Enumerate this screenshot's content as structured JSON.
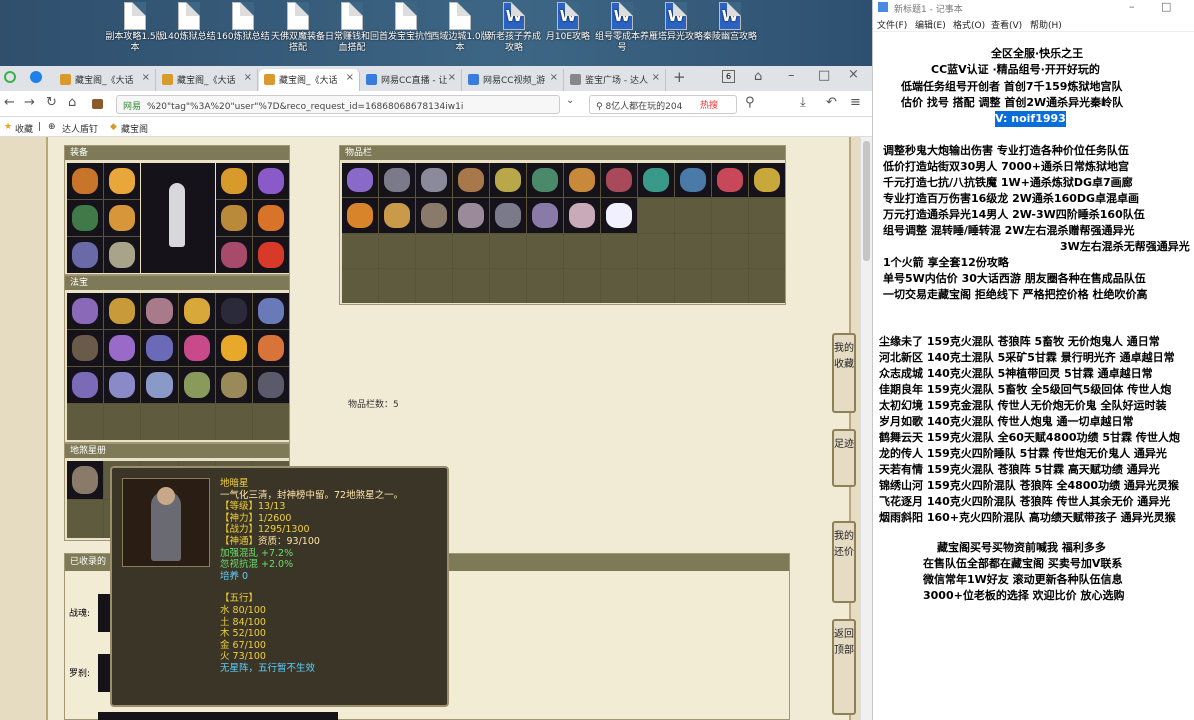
{
  "desktop": {
    "icons": [
      {
        "label": "副本攻略1.5版本",
        "type": "doc"
      },
      {
        "label": "140炼狱总结",
        "type": "doc"
      },
      {
        "label": "160炼狱总结",
        "type": "doc"
      },
      {
        "label": "天佛双魔装备搭配",
        "type": "doc"
      },
      {
        "label": "日常赚钱和回血搭配",
        "type": "doc"
      },
      {
        "label": "首发宝宝抗性",
        "type": "doc"
      },
      {
        "label": "西域边城1.0版本",
        "type": "doc"
      },
      {
        "label": "新老孩子养成攻略",
        "type": "word"
      },
      {
        "label": "月10E攻略",
        "type": "word"
      },
      {
        "label": "组号零成本养号",
        "type": "word"
      },
      {
        "label": "雁塔异光攻略",
        "type": "word"
      },
      {
        "label": "秦陵幽宫攻略",
        "type": "word"
      }
    ]
  },
  "browser": {
    "tabs": [
      {
        "label": "藏宝阁_《大话"
      },
      {
        "label": "藏宝阁_《大话"
      },
      {
        "label": "藏宝阁_《大话",
        "active": true
      },
      {
        "label": "网易CC直播 - 让"
      },
      {
        "label": "网易CC视频_游"
      },
      {
        "label": "鉴宝广场 - 达人"
      }
    ],
    "tab_count": "6",
    "url_site": "网易",
    "url_text": "%20\"tag\"%3A%20\"user\"%7D&reco_request_id=16868068678134iw1i",
    "search_text": "8亿人都在玩的204",
    "hot_label": "热搜",
    "bookmarks": {
      "fav": "收藏",
      "a": "达人盾钉",
      "b": "藏宝阁"
    }
  },
  "game": {
    "equip_title": "装备",
    "items_title": "物品栏",
    "fabao_title": "法宝",
    "star_title": "地煞星册",
    "collected_title": "已收录的",
    "item_count": "物品栏数：5",
    "label_zhanhun": "战魂:",
    "label_luosha": "罗刹:",
    "side_buttons": [
      "我的收藏",
      "足迹",
      "我的还价",
      "返回顶部"
    ],
    "tooltip": {
      "name": "地暗星",
      "desc": "一气化三清，封神榜中留。72地煞星之一。",
      "l1": "【等级】13/13",
      "l2": "【神力】1/2600",
      "l3": "【战力】1295/1300",
      "l4a": "【神通】",
      "l4b": "资质：93/100",
      "l5": "加强混乱 +7.2%",
      "l6": "忽视抗混 +2.0%",
      "l7": "培养 0",
      "wx": "【五行】",
      "w1": "水 80/100",
      "w2": "土 84/100",
      "w3": "木 52/100",
      "w4": "金 67/100",
      "w5": "火 73/100",
      "last": "无星阵，五行暂不生效"
    }
  },
  "notepad": {
    "title": "新标题1 - 记事本",
    "menu": [
      "文件(F)",
      "编辑(E)",
      "格式(O)",
      "查看(V)",
      "帮助(H)"
    ],
    "lines": [
      "全区全服·快乐之王",
      "CC蓝V认证 ·精品组号·开开好玩的",
      "低端任务组号开创者          首创7千159炼狱地宫队",
      "估价 找号 搭配 调整          首创2W通杀异光秦岭队",
      "V: noif1993",
      "调整秒鬼大炮输出伤害          专业打造各种价位任务队伍",
      "低价打造站街双30男人          7000+通杀日常炼狱地宫",
      "千元打造七抗/八抗铁魔          1W+通杀炼狱DG卓7画廊",
      "专业打造百万伤害16级龙          2W通杀160DG卓混卓画",
      "万元打造通杀异光14男人          2W-3W四阶睡杀160队伍",
      "组号调整 混转睡/睡转混          2W左右混杀赠帮强通异光",
      "3W左右混杀无帮强通异光",
      "1个火箭 享全套12份攻略",
      "单号5W内估价 30大话西游          朋友圈各种在售成品队伍",
      "一切交易走藏宝阁 拒绝线下          严格把控价格 杜绝吹价高",
      "尘缘未了 159克火混队 苍狼阵 5畜牧 无价炮鬼人 通日常",
      "河北新区 140克土混队 5采矿5甘霖 景行明光齐 通卓越日常",
      "众志成城 140克火混队 5神植带回灵 5甘霖 通卓越日常",
      "佳期良年 159克火混队 5畜牧 全5级回气5级回体 传世人炮",
      "太初幻境 159克金混队 传世人无价炮无价鬼 全队好运时装",
      "岁月如歌 140克火混队 传世人炮鬼 通一切卓越日常",
      "鹤舞云天 159克火混队 全60天赋4800功绩 5甘霖 传世人炮",
      "龙的传人 159克火四阶睡队 5甘霖 传世炮无价鬼人 通异光",
      "天若有情 159克火混队 苍狼阵 5甘霖 高天赋功绩 通异光",
      "锦绣山河 159克火四阶混队 苍狼阵 全4800功绩 通异光灵猴",
      "飞花逐月 140克火四阶混队 苍狼阵 传世人其余无价 通异光",
      "烟雨斜阳 160+克火四阶混队 高功绩天赋带孩子 通异光灵猴",
      "藏宝阁买号买物资前喊我 福利多多",
      "在售队伍全部都在藏宝阁 买卖号加V联系",
      "微信常年1W好友 滚动更新各种队伍信息",
      "3000+位老板的选择 欢迎比价 放心选购"
    ]
  }
}
